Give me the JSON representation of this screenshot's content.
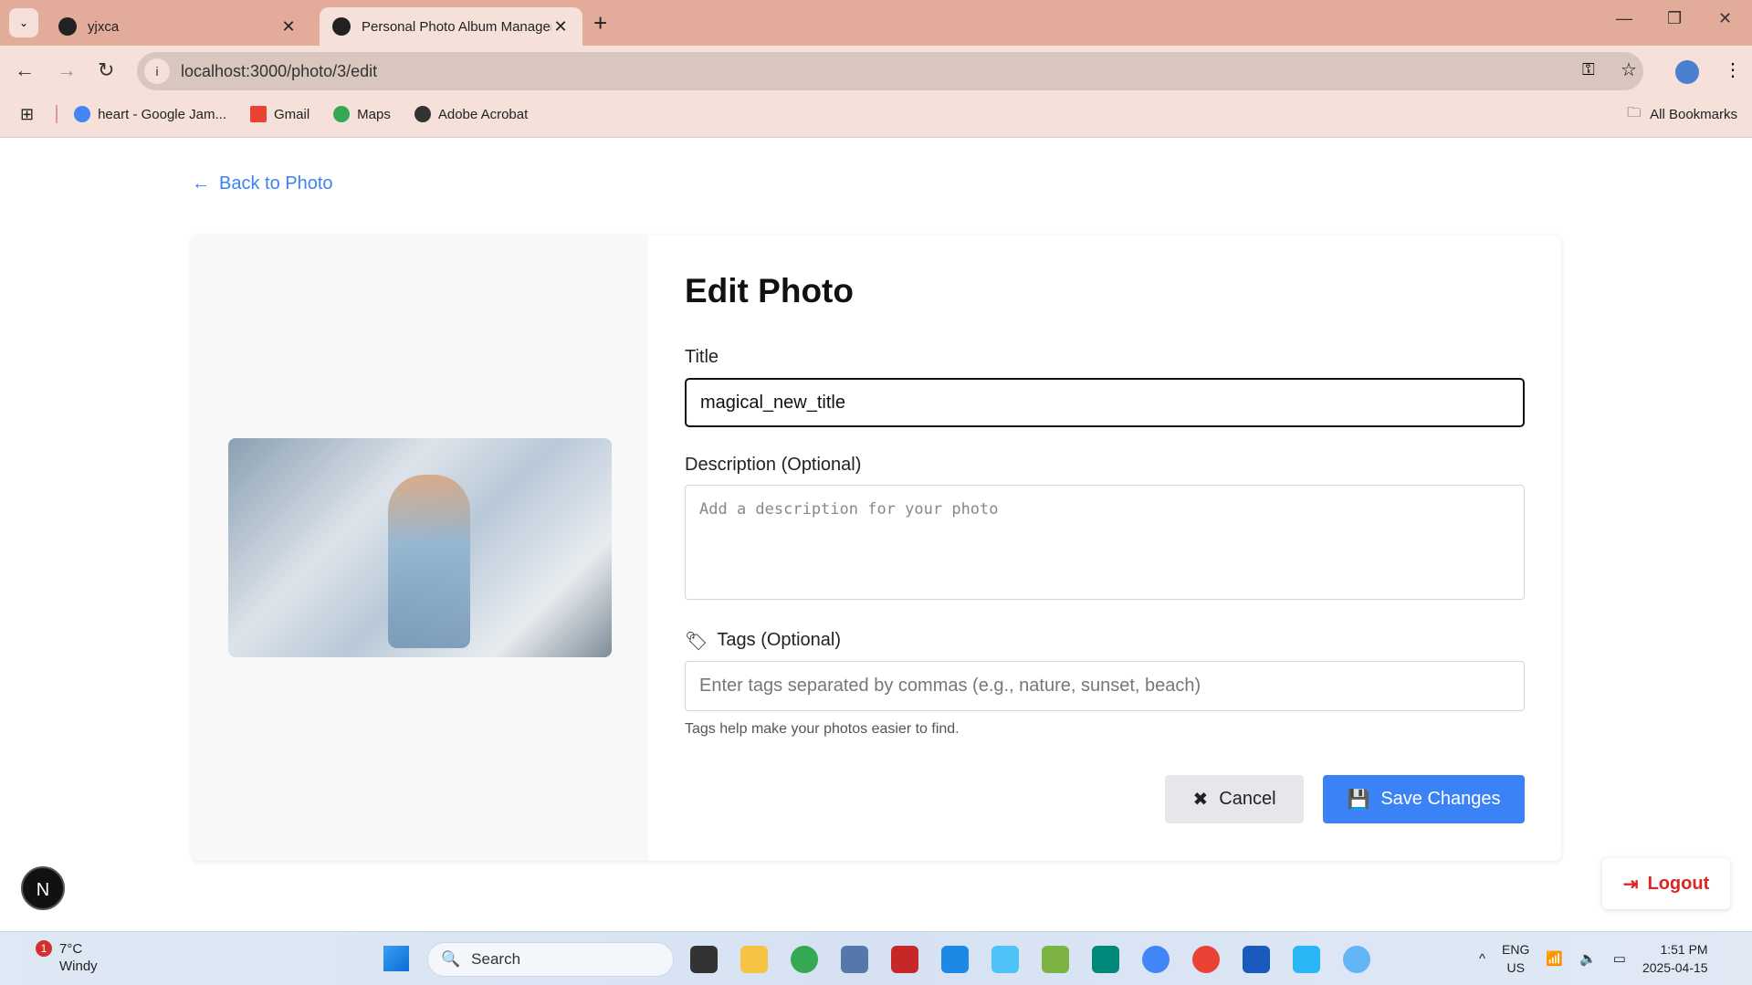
{
  "browser": {
    "tabs": [
      {
        "label": "yjxca"
      },
      {
        "label": "Personal Photo Album Manager"
      }
    ],
    "url": "localhost:3000/photo/3/edit",
    "bookmarks": [
      {
        "label": "heart - Google Jam..."
      },
      {
        "label": "Gmail"
      },
      {
        "label": "Maps"
      },
      {
        "label": "Adobe Acrobat"
      }
    ],
    "all_bookmarks": "All Bookmarks"
  },
  "page": {
    "back_link": "Back to Photo",
    "heading": "Edit Photo",
    "title_label": "Title",
    "title_value": "magical_new_title",
    "description_label": "Description (Optional)",
    "description_placeholder": "Add a description for your photo",
    "tags_label": "Tags (Optional)",
    "tags_placeholder": "Enter tags separated by commas (e.g., nature, sunset, beach)",
    "tags_help": "Tags help make your photos easier to find.",
    "cancel": "Cancel",
    "save": "Save Changes",
    "logout": "Logout",
    "avatar_letter": "N"
  },
  "taskbar": {
    "temp": "7°C",
    "weather": "Windy",
    "badge": "1",
    "search": "Search",
    "lang1": "ENG",
    "lang2": "US",
    "time": "1:51 PM",
    "date": "2025-04-15"
  },
  "colors": {
    "accent": "#3b82f6",
    "danger": "#dc2626"
  }
}
